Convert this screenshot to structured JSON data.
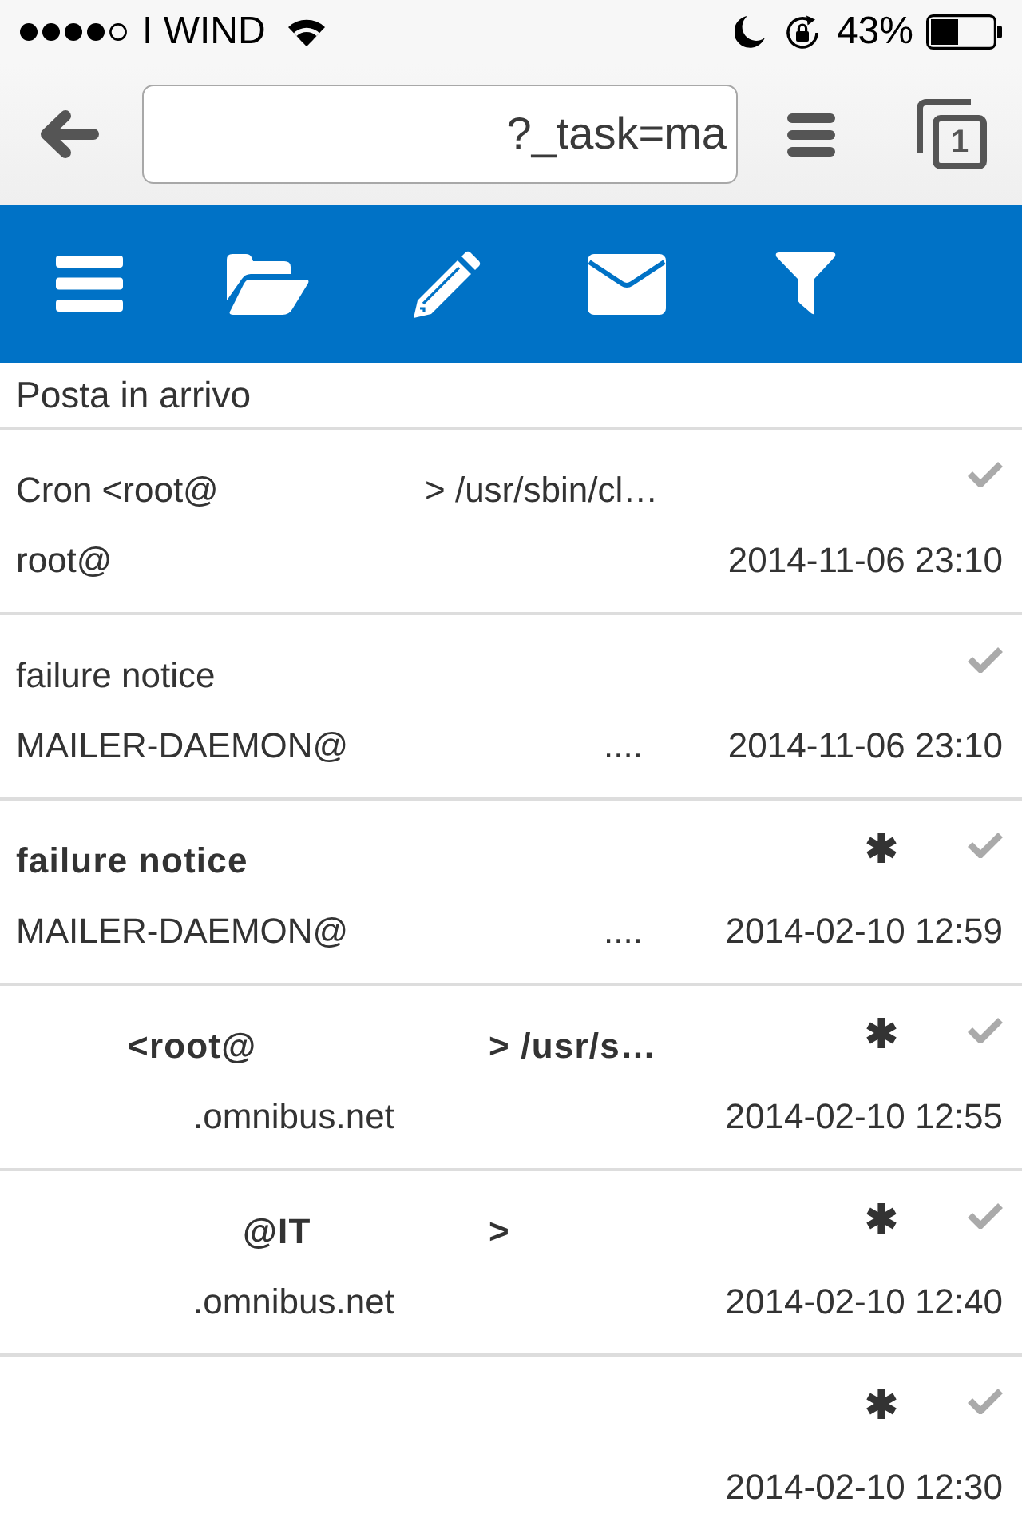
{
  "status_bar": {
    "carrier": "I WIND",
    "battery": "43%"
  },
  "browser": {
    "url": "?_task=ma",
    "tab_count": "1"
  },
  "folder": {
    "title": "Posta in arrivo"
  },
  "messages": [
    {
      "subject": [
        "Cron <root@",
        "> /usr/sbin/cl…"
      ],
      "sender": [
        "root@"
      ],
      "date": "2014-11-06 23:10",
      "unread": false
    },
    {
      "subject": [
        "failure notice"
      ],
      "sender": [
        "MAILER-DAEMON@",
        "...."
      ],
      "date": "2014-11-06 23:10",
      "unread": false
    },
    {
      "subject": [
        "failure notice"
      ],
      "sender": [
        "MAILER-DAEMON@",
        "...."
      ],
      "date": "2014-02-10 12:59",
      "unread": true
    },
    {
      "subject": [
        "<root@",
        "> /usr/s…"
      ],
      "sender": [
        ".omnibus.net"
      ],
      "date": "2014-02-10 12:55",
      "unread": true
    },
    {
      "subject": [
        "@IT",
        ">"
      ],
      "sender": [
        ".omnibus.net"
      ],
      "date": "2014-02-10 12:40",
      "unread": true
    },
    {
      "date": "2014-02-10 12:30",
      "unread": true
    }
  ]
}
